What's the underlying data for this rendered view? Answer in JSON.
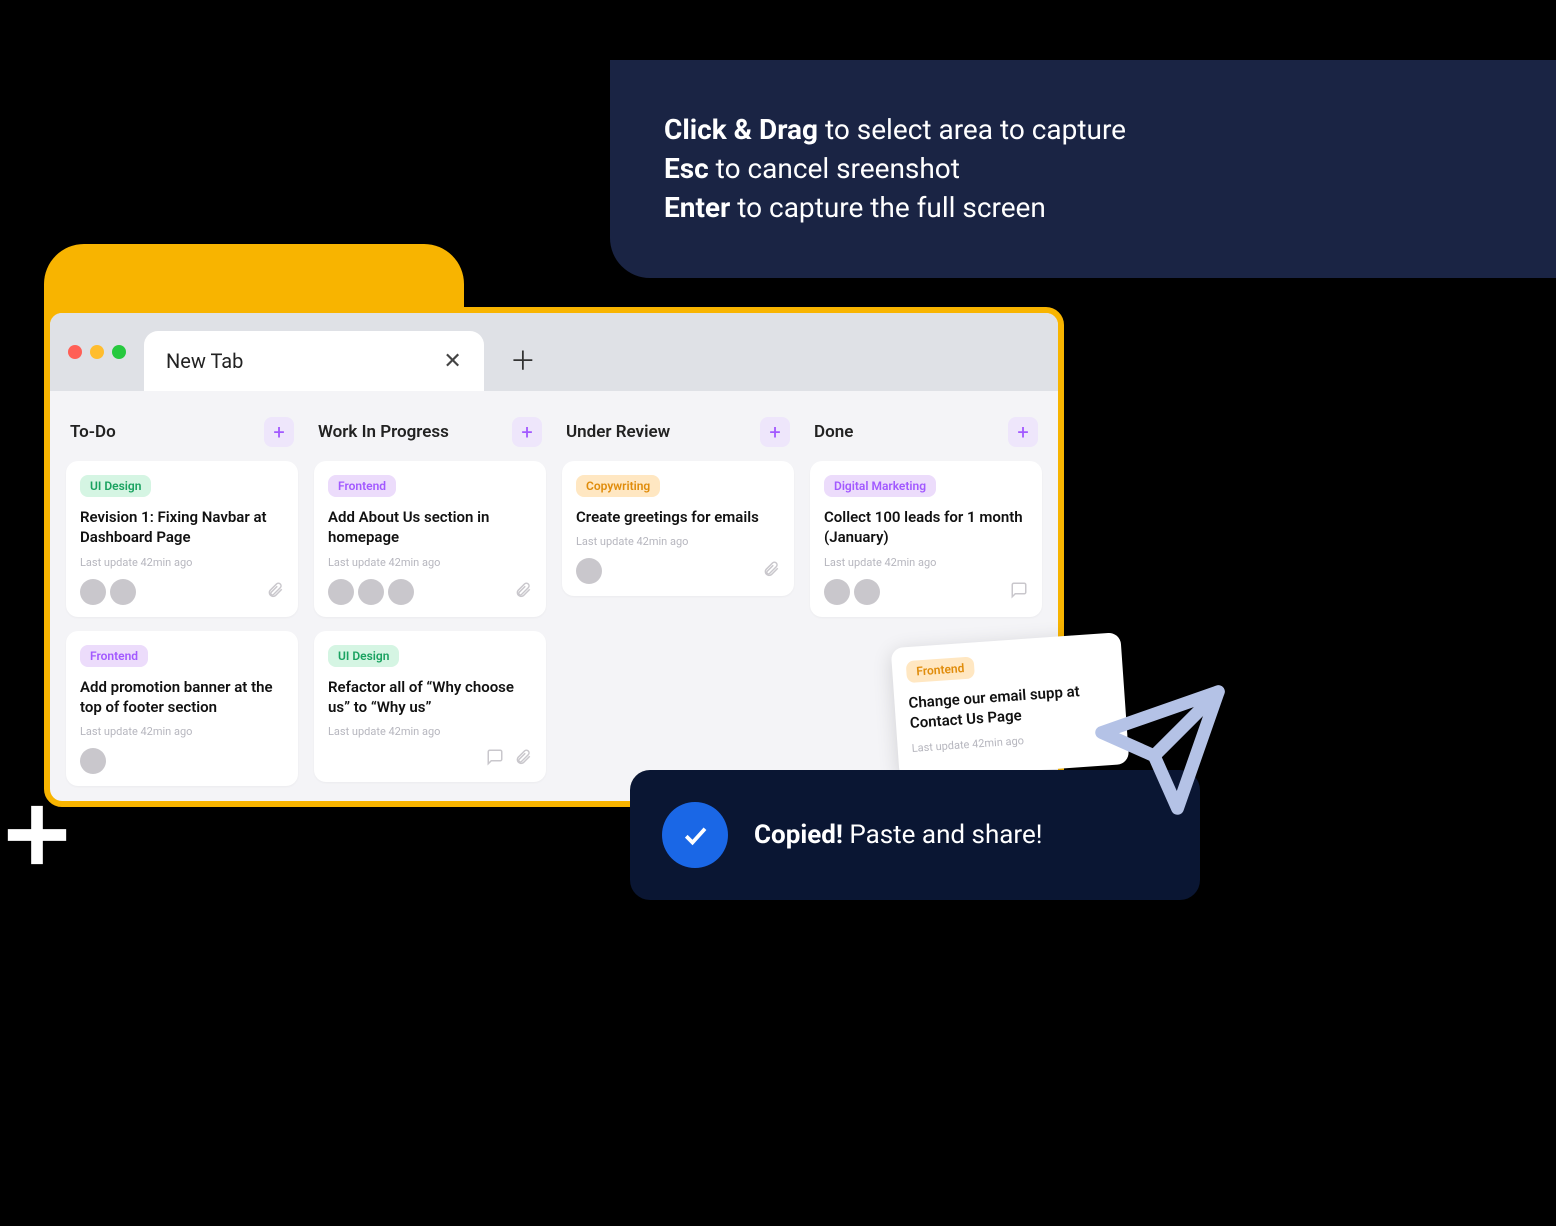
{
  "instructions": {
    "line1_bold": "Click & Drag",
    "line1_rest": " to select area to capture",
    "line2_bold": "Esc",
    "line2_rest": " to cancel sreenshot",
    "line3_bold": "Enter",
    "line3_rest": " to capture the full screen"
  },
  "browser": {
    "tab_label": "New Tab"
  },
  "columns": [
    {
      "title": "To-Do",
      "cards": [
        {
          "tag": "UI Design",
          "tag_class": "tag-green",
          "title": "Revision 1: Fixing Navbar at Dashboard Page",
          "meta": "Last update 42min ago",
          "avatars": 2,
          "icons": [
            "clip"
          ]
        },
        {
          "tag": "Frontend",
          "tag_class": "tag-purple",
          "title": "Add promotion banner at the top of footer section",
          "meta": "Last update 42min ago",
          "avatars": 1,
          "icons": []
        }
      ]
    },
    {
      "title": "Work In Progress",
      "cards": [
        {
          "tag": "Frontend",
          "tag_class": "tag-purple",
          "title": "Add About Us section in homepage",
          "meta": "Last update 42min ago",
          "avatars": 3,
          "icons": [
            "clip"
          ]
        },
        {
          "tag": "UI Design",
          "tag_class": "tag-green",
          "title": "Refactor all of “Why choose us” to “Why us”",
          "meta": "Last update 42min ago",
          "avatars": 0,
          "icons": [
            "chat",
            "clip"
          ]
        }
      ]
    },
    {
      "title": "Under Review",
      "cards": [
        {
          "tag": "Copywriting",
          "tag_class": "tag-orange",
          "title": "Create greetings for emails",
          "meta": "Last update 42min ago",
          "avatars": 1,
          "icons": [
            "clip"
          ]
        }
      ]
    },
    {
      "title": "Done",
      "cards": [
        {
          "tag": "Digital Marketing",
          "tag_class": "tag-purple",
          "title": "Collect 100 leads for 1 month (January)",
          "meta": "Last update 42min ago",
          "avatars": 2,
          "icons": [
            "chat"
          ]
        }
      ]
    }
  ],
  "tilted_card": {
    "tag": "Frontend",
    "title": "Change our email supp at Contact Us Page",
    "meta": "Last update 42min ago"
  },
  "toast": {
    "bold": "Copied!",
    "rest": " Paste and share!"
  }
}
